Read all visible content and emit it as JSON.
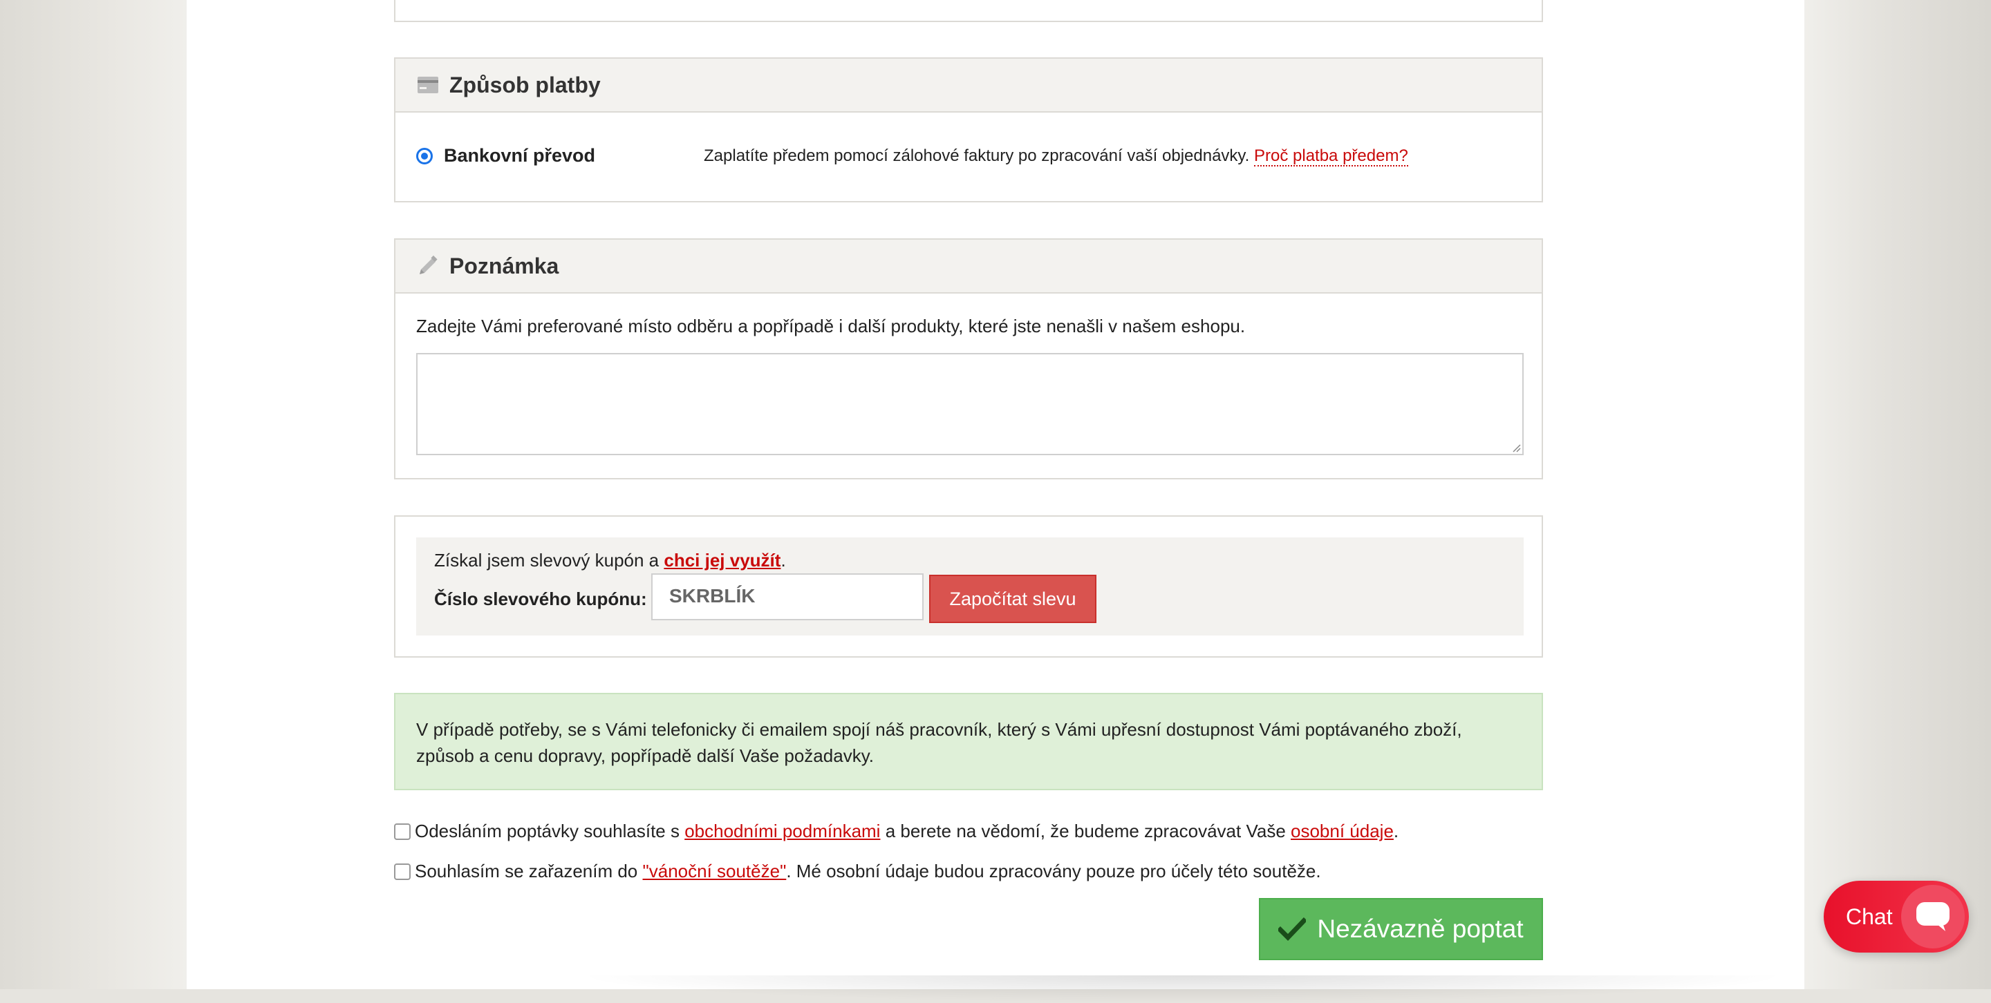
{
  "payment": {
    "title": "Způsob platby",
    "option_label": "Bankovní převod",
    "option_desc": "Zaplatíte předem pomocí zálohové faktury po zpracování vaší objednávky.",
    "why_link": "Proč platba předem?"
  },
  "note": {
    "title": "Poznámka",
    "instruction": "Zadejte Vámi preferované místo odběru a popřípadě i další produkty, které jste nenašli v našem eshopu.",
    "value": ""
  },
  "coupon": {
    "text_prefix": "Získal jsem slevový kupón a ",
    "use_link": "chci jej využít",
    "text_suffix": ".",
    "label": "Číslo slevového kupónu:",
    "value": "SKRBLÍK",
    "button": "Započítat slevu"
  },
  "info": {
    "line1": "V případě potřeby, se s Vámi telefonicky či emailem spojí náš pracovník, který s Vámi upřesní dostupnost Vámi poptávaného zboží,",
    "line2": "způsob a cenu dopravy, popřípadě další Vaše požadavky."
  },
  "terms": {
    "prefix": "Odesláním poptávky souhlasíte s ",
    "terms_link": "obchodními podmínkami",
    "middle": " a berete na vědomí, že budeme zpracovávat Vaše ",
    "privacy_link": "osobní údaje",
    "suffix": "."
  },
  "contest": {
    "prefix": "Souhlasím se zařazením do ",
    "link": "\"vánoční soutěže\"",
    "suffix": ". Mé osobní údaje budou zpracovány pouze pro účely této soutěže."
  },
  "submit": {
    "label": "Nezávazně poptat"
  },
  "chat": {
    "label": "Chat"
  },
  "colors": {
    "accent_red": "#c90a0a",
    "coupon_button": "#d9534f",
    "submit_green": "#5cb85c",
    "info_bg": "#dff0d8",
    "radio_blue": "#1a73e8",
    "chat_red": "#e8112b"
  }
}
